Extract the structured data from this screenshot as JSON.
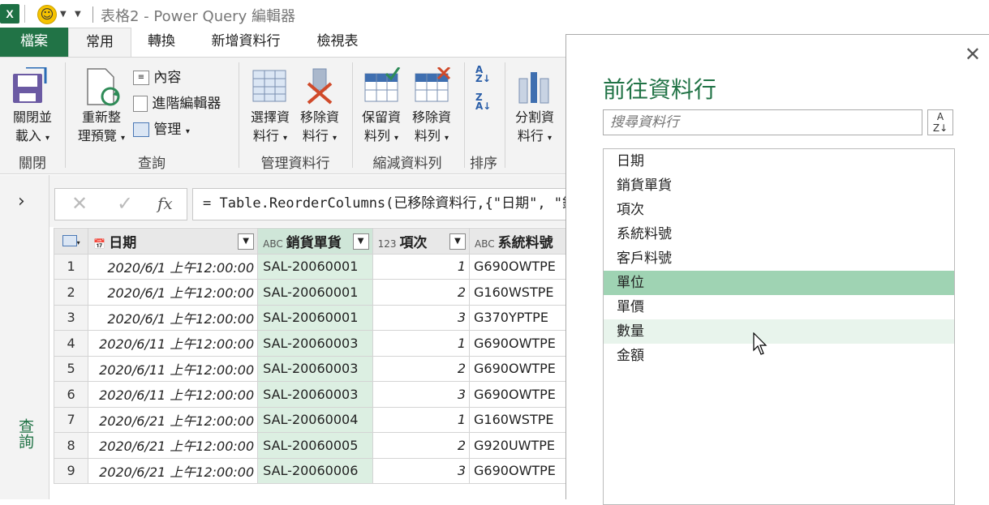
{
  "window": {
    "title": "表格2 - Power Query 編輯器",
    "app_icon": "excel-icon",
    "quick_access_icon": "smiley-icon"
  },
  "tabs": [
    "檔案",
    "常用",
    "轉換",
    "新增資料行",
    "檢視表"
  ],
  "ribbon": {
    "close_load": {
      "line1": "關閉並",
      "line2": "載入"
    },
    "refresh": {
      "line1": "重新整",
      "line2": "理預覽"
    },
    "properties": "內容",
    "advanced_editor": "進階編輯器",
    "manage": "管理",
    "choose_columns": {
      "line1": "選擇資",
      "line2": "料行"
    },
    "remove_columns": {
      "line1": "移除資",
      "line2": "料行"
    },
    "keep_rows": {
      "line1": "保留資",
      "line2": "料列"
    },
    "remove_rows": {
      "line1": "移除資",
      "line2": "料列"
    },
    "split_column": {
      "line1": "分割資",
      "line2": "料行"
    },
    "groups": {
      "close": "關閉",
      "query": "查詢",
      "manage_columns": "管理資料行",
      "reduce_rows": "縮減資料列",
      "sort": "排序"
    }
  },
  "query_pane": {
    "label": "查詢"
  },
  "formula_bar": {
    "formula": "= Table.ReorderColumns(已移除資料行,{\"日期\", \"銷"
  },
  "grid": {
    "columns": [
      {
        "type": "date-icon",
        "name": "日期"
      },
      {
        "type": "ABC",
        "name": "銷貨單貨"
      },
      {
        "type": "123",
        "name": "項次"
      },
      {
        "type": "ABC",
        "name": "系統料號"
      }
    ],
    "rows": [
      [
        "1",
        "2020/6/1 上午12:00:00",
        "SAL-20060001",
        "1",
        "G690OWTPE"
      ],
      [
        "2",
        "2020/6/1 上午12:00:00",
        "SAL-20060001",
        "2",
        "G160WSTPE"
      ],
      [
        "3",
        "2020/6/1 上午12:00:00",
        "SAL-20060001",
        "3",
        "G370YPTPE"
      ],
      [
        "4",
        "2020/6/11 上午12:00:00",
        "SAL-20060003",
        "1",
        "G690OWTPE"
      ],
      [
        "5",
        "2020/6/11 上午12:00:00",
        "SAL-20060003",
        "2",
        "G690OWTPE"
      ],
      [
        "6",
        "2020/6/11 上午12:00:00",
        "SAL-20060003",
        "3",
        "G690OWTPE"
      ],
      [
        "7",
        "2020/6/21 上午12:00:00",
        "SAL-20060004",
        "1",
        "G160WSTPE"
      ],
      [
        "8",
        "2020/6/21 上午12:00:00",
        "SAL-20060005",
        "2",
        "G920UWTPE"
      ],
      [
        "9",
        "2020/6/21 上午12:00:00",
        "SAL-20060006",
        "3",
        "G690OWTPE"
      ]
    ]
  },
  "go_to_column": {
    "title": "前往資料行",
    "search_placeholder": "搜尋資料行",
    "items": [
      "日期",
      "銷貨單貨",
      "項次",
      "系統料號",
      "客戶料號",
      "單位",
      "單價",
      "數量",
      "金額"
    ],
    "selected_index": 5,
    "hover_index": 7
  },
  "colors": {
    "accent": "#217346",
    "selected_row": "#9fd3b3",
    "selected_col": "#dcefe2"
  }
}
